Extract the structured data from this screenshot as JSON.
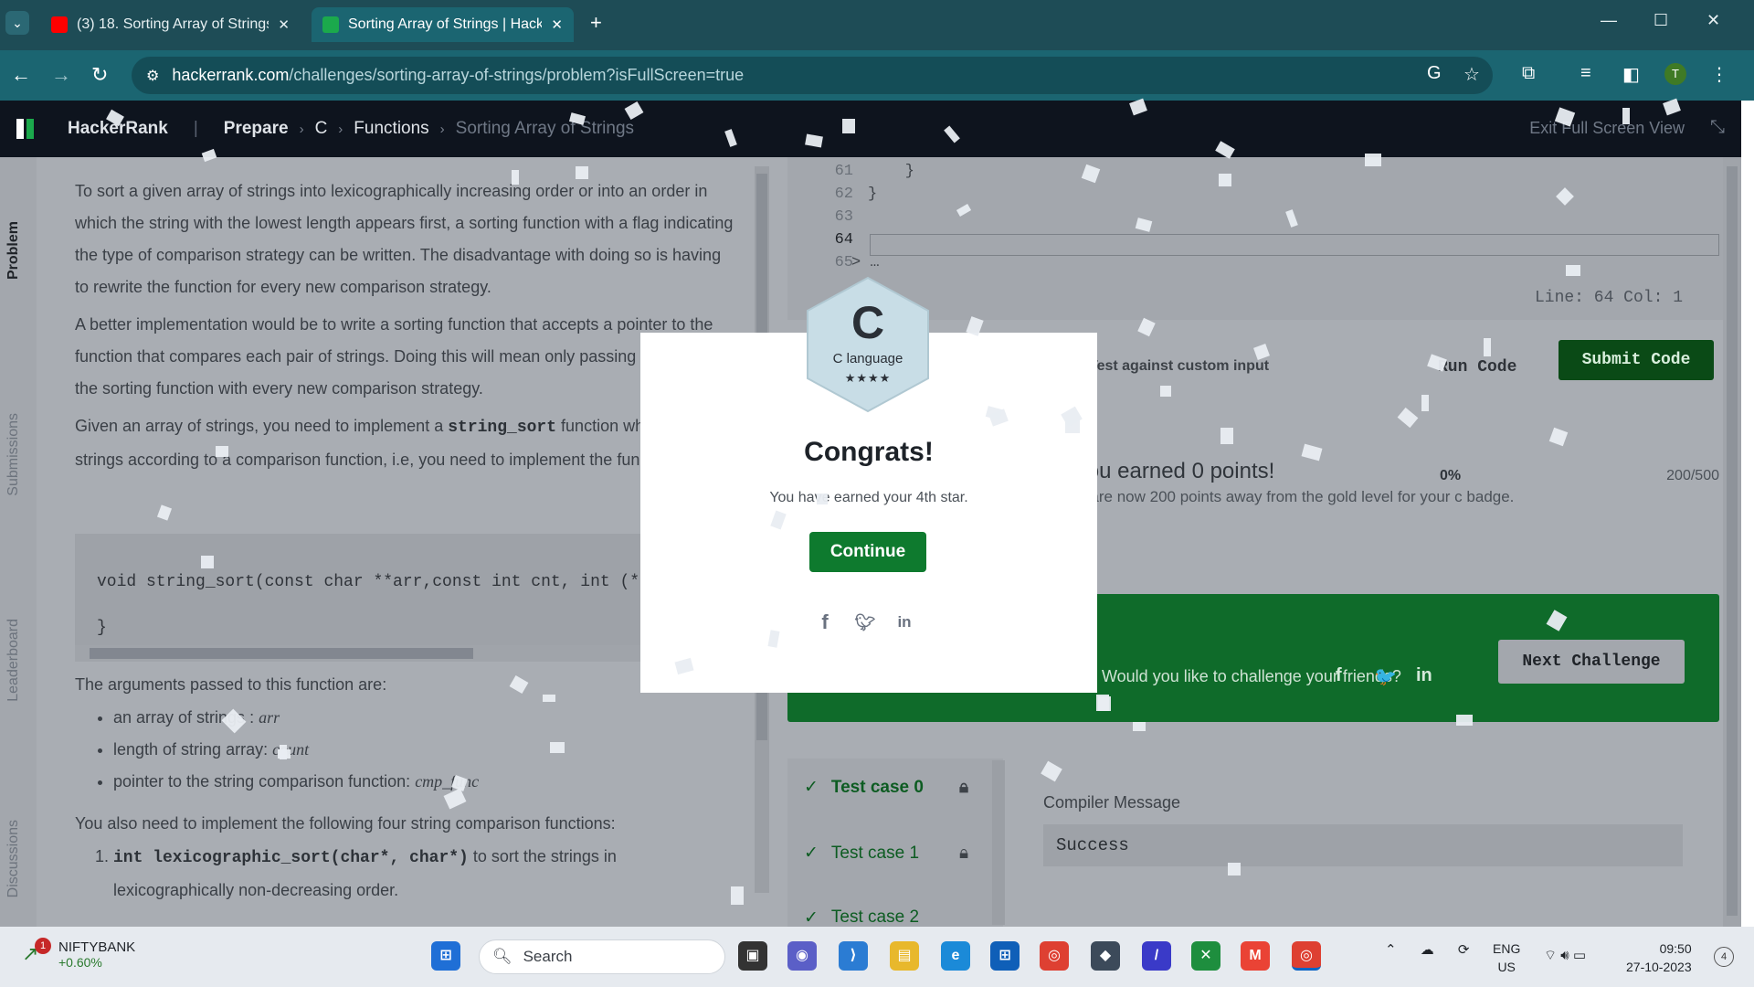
{
  "browser": {
    "tabs": [
      {
        "title": "(3) 18. Sorting Array of Strings",
        "icon": "youtube-icon"
      },
      {
        "title": "Sorting Array of Strings | Hack",
        "icon": "hackerrank-icon"
      }
    ],
    "url_host": "hackerrank.com",
    "url_path": "/challenges/sorting-array-of-strings/problem?isFullScreen=true",
    "profile_initial": "T"
  },
  "hr_nav": {
    "brand": "HackerRank",
    "crumbs": [
      "Prepare",
      "C",
      "Functions",
      "Sorting Array of Strings"
    ],
    "exit_full_screen": "Exit Full Screen View"
  },
  "side_tabs": [
    "Problem",
    "Submissions",
    "Leaderboard",
    "Discussions"
  ],
  "problem": {
    "para1": "To sort a given array of strings into lexicographically increasing order or into an order in which the string with the lowest length appears first, a sorting function with a flag indicating the type of comparison strategy can be written. The disadvantage with doing so is having to rewrite the function for every new comparison strategy.",
    "para2": "A better implementation would be to write a sorting function that accepts a pointer to the function that compares each pair of strings. Doing this will mean only passing a pointer to the sorting function with every new comparison strategy.",
    "para3_a": "Given an array of strings, you need to implement a ",
    "para3_code": "string_sort",
    "para3_b": " function which sorts the strings according to a comparison function, i.e, you need to implement the function :",
    "code_line1": "void string_sort(const char **arr,const int cnt, int (*cmp_func)(const char* a, const char* b)){",
    "code_line2": "}",
    "args_title": "The arguments passed to this function are:",
    "args": [
      {
        "text": "an array of strings : ",
        "math": "arr"
      },
      {
        "text": "length of string array: ",
        "math": "count"
      },
      {
        "text": "pointer to the string comparison function: ",
        "math": "cmp_func"
      }
    ],
    "impl_title": "You also need to implement the following four string comparison functions:",
    "impl1_code": "int lexicographic_sort(char*, char*)",
    "impl1_text": " to sort the strings in lexicographically non-decreasing order."
  },
  "editor": {
    "lines": [
      {
        "num": "61",
        "code": "    }"
      },
      {
        "num": "62",
        "code": "}"
      },
      {
        "num": "63",
        "code": ""
      },
      {
        "num": "64",
        "code": ""
      },
      {
        "num": "65",
        "code": "> …"
      }
    ],
    "status": "Line: 64 Col: 1"
  },
  "actions": {
    "custom_input": "Test against custom input",
    "run_code": "Run Code",
    "submit_code": "Submit Code"
  },
  "points": {
    "title": "You earned 0 points!",
    "subtitle": "You are now 200 points away from the gold level for your c badge.",
    "percent": "0%",
    "value": "200/500"
  },
  "banner": {
    "question": "Would you like to challenge your friends?",
    "next_challenge": "Next Challenge"
  },
  "tests": {
    "cases": [
      "Test case 0",
      "Test case 1",
      "Test case 2"
    ],
    "compiler_label": "Compiler Message",
    "compiler_output": "Success"
  },
  "modal": {
    "badge_letter": "C",
    "badge_label": "C language",
    "badge_stars": "★★★★",
    "title": "Congrats!",
    "message": "You have earned your 4th star.",
    "continue": "Continue"
  },
  "taskbar": {
    "stock_name": "NIFTYBANK",
    "stock_change": "+0.60%",
    "stock_badge": "1",
    "search": "Search",
    "lang1": "ENG",
    "lang2": "US",
    "time": "09:50",
    "date": "27-10-2023",
    "notif": "4"
  },
  "colors": {
    "hr_green": "#0e7a2e",
    "hr_nav": "#0e141e",
    "browser_bar": "#1b6571"
  }
}
